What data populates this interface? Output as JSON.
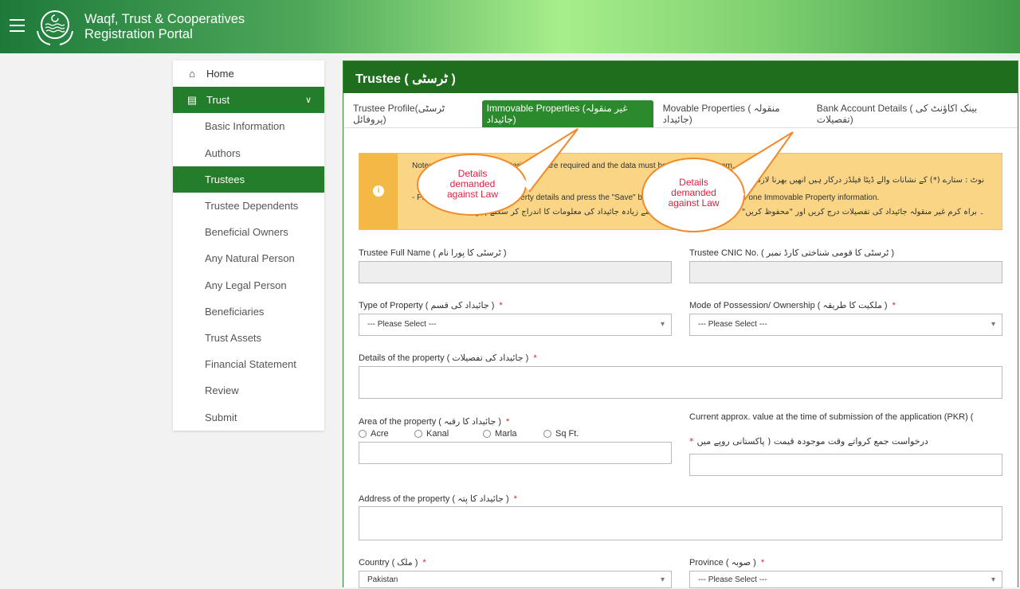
{
  "header": {
    "title_line1": "Waqf, Trust & Cooperatives",
    "title_line2": "Registration Portal",
    "menu_icon": "hamburger-icon",
    "logo": "punjab-government-seal"
  },
  "sidebar": {
    "items": [
      {
        "label": "Home",
        "icon": "home-icon"
      },
      {
        "label": "Trust",
        "icon": "document-icon",
        "expanded": true,
        "active": true
      },
      {
        "label": "Basic Information"
      },
      {
        "label": "Authors"
      },
      {
        "label": "Trustees",
        "active": true
      },
      {
        "label": "Trustee Dependents"
      },
      {
        "label": "Beneficial Owners"
      },
      {
        "label": "Any Natural Person"
      },
      {
        "label": "Any Legal Person"
      },
      {
        "label": "Beneficiaries"
      },
      {
        "label": "Trust Assets"
      },
      {
        "label": "Financial Statement"
      },
      {
        "label": "Review"
      },
      {
        "label": "Submit"
      }
    ]
  },
  "main": {
    "title": "Trustee ( ٹرسٹی )",
    "tabs": [
      {
        "label": "Trustee Profile(ٹرسٹی پروفائل)"
      },
      {
        "label": "Immovable Properties (غیر منقولہ جائیداد)",
        "active": true
      },
      {
        "label": "Movable Properties ( منقولہ جائیداد)"
      },
      {
        "label": "Bank Account Details ( بینک اکاؤنٹ کی تفصیلات)"
      }
    ],
    "note": {
      "line1": "Note: Fields marked with asterisk ( * ) are required and the data must be entered with them.",
      "line2": "نوٹ : ستارے (*) کے نشانات والے ڈیٹا فیلڈز درکار ہیں انھیں بھرنا لازمی ہے اور",
      "line3": "- Please enter immovable property details and press the \"Save\" button. You can add more than one Immovable Property information.",
      "line4": "۔ براہ کرم غیر منقولہ جائیداد کی تفصیلات درج کریں اور \"محفوظ کریں\" کے بٹن کو دبائیں۔ آپ ایک سے زیادہ جائیداد کی معلومات کا اندراج کر سکتے ہیں۔",
      "icon": "info-icon"
    },
    "callouts": [
      "Details demanded against Law",
      "Details demanded against Law"
    ],
    "form": {
      "full_name_label": "Trustee Full Name ( ٹرسٹی کا پورا نام )",
      "full_name_value": "",
      "cnic_label": "Trustee CNIC No. ( ٹرسٹی کا قومی شناختی کارڈ نمبر )",
      "cnic_value": "",
      "type_label": "Type of Property ( جائیداد کی قسم )",
      "type_value": "--- Please Select ---",
      "mode_label": "Mode of Possession/ Ownership ( ملکیت کا طریقہ )",
      "mode_value": "--- Please Select ---",
      "details_label": "Details of the property ( جائیداد کی تفصیلات )",
      "area_label": "Area of the property ( جائیداد کا رقبہ )",
      "area_units": [
        "Acre",
        "Kanal",
        "Marla",
        "Sq Ft."
      ],
      "value_label1": "Current approx. value at the time of submission of the application (PKR) (",
      "value_label2": "درخواست جمع کرواتے وقت موجودہ قیمت ( پاکستانی روپے میں",
      "address_label": "Address of the property ( جائیداد کا پتہ )",
      "country_label": "Country ( ملک )",
      "country_value": "Pakistan",
      "province_label": "Province ( صوبہ )",
      "province_value": "--- Please Select ---",
      "required_mark": "*"
    }
  },
  "colors": {
    "primary_green": "#237d2a",
    "note_bg": "#f9d585",
    "required": "#e02020",
    "callout_text": "#e02040",
    "callout_border": "#f08a2a"
  }
}
